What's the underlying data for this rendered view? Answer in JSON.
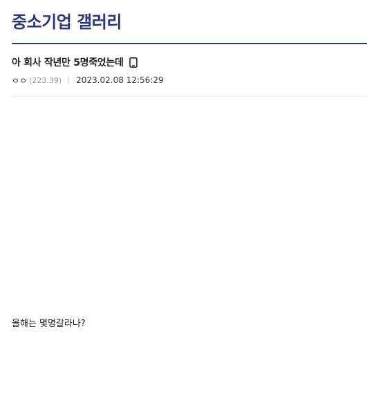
{
  "gallery": {
    "title": "중소기업 갤러리"
  },
  "post": {
    "title": "아 회사 작년만 5명죽었는데",
    "device_icon": "mobile-phone-icon",
    "writer_nick": "ㅇㅇ",
    "writer_ip": "(223.39)",
    "date": "2023.02.08 12:56:29",
    "body": "올해는 몇명갈라나?"
  },
  "colors": {
    "accent": "#29367c",
    "text": "#222222",
    "muted": "#999999",
    "divider": "#cccccc"
  }
}
